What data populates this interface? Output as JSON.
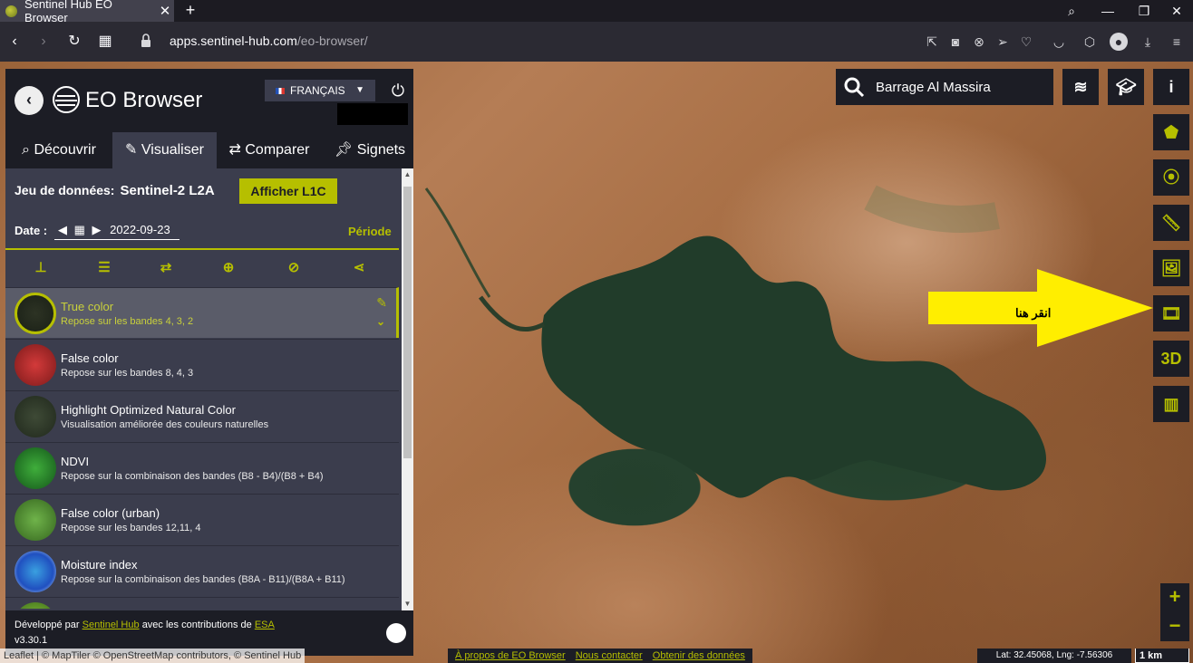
{
  "browser": {
    "tab_title": "Sentinel Hub EO Browser",
    "url_host": "apps.sentinel-hub.com",
    "url_path": "/eo-browser/"
  },
  "panel": {
    "brand": "EO Browser",
    "language": "FRANÇAIS",
    "tabs": [
      {
        "label": "Découvrir",
        "icon": "search-icon"
      },
      {
        "label": "Visualiser",
        "icon": "brush-icon",
        "active": true
      },
      {
        "label": "Comparer",
        "icon": "swap-icon"
      },
      {
        "label": "Signets",
        "icon": "pin-icon"
      }
    ],
    "dataset_label": "Jeu de données:",
    "dataset_value": "Sentinel-2 L2A",
    "l1c_button": "Afficher L1C",
    "date_label": "Date :",
    "date_value": "2022-09-23",
    "period": "Période",
    "layers": [
      {
        "name": "True color",
        "desc": "Repose sur les bandes 4, 3, 2",
        "selected": true
      },
      {
        "name": "False color",
        "desc": "Repose sur les bandes 8, 4, 3"
      },
      {
        "name": "Highlight Optimized Natural Color",
        "desc": "Visualisation améliorée des couleurs naturelles"
      },
      {
        "name": "NDVI",
        "desc": "Repose sur la combinaison des bandes (B8 - B4)/(B8 + B4)"
      },
      {
        "name": "False color (urban)",
        "desc": "Repose sur les bandes 12,11, 4"
      },
      {
        "name": "Moisture index",
        "desc": "Repose sur la combinaison des bandes (B8A - B11)/(B8A + B11)"
      }
    ],
    "footer_prefix": "Développé par",
    "footer_link1": "Sentinel Hub",
    "footer_mid": "avec les contributions de",
    "footer_link2": "ESA",
    "version": "v3.30.1"
  },
  "map": {
    "search_value": "Barrage Al Massira",
    "annotation_text": "انقر هنا",
    "attribution": "Leaflet | © MapTiler © OpenStreetMap contributors, © Sentinel Hub",
    "links": [
      "À propos de EO Browser",
      "Nous contacter",
      "Obtenir des données"
    ],
    "coords": "Lat: 32.45068, Lng: -7.56306",
    "scale": "1 km",
    "side_3d": "3D",
    "zoom_in": "+",
    "zoom_out": "−"
  },
  "colors": {
    "accent": "#b6bf00",
    "panel_dark": "#1c1d25",
    "panel_mid": "#3b3d4d",
    "arrow": "#ffee00"
  }
}
